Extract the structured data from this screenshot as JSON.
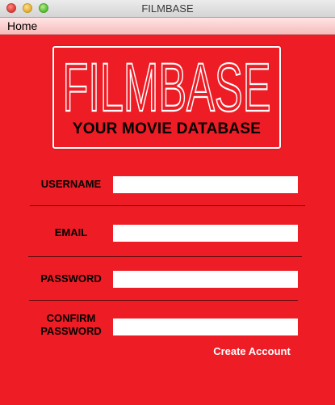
{
  "window": {
    "title": "FILMBASE"
  },
  "menu": {
    "items": [
      "Home"
    ]
  },
  "logo": {
    "wordmark": "FILMBASE",
    "tagline": "YOUR MOVIE DATABASE"
  },
  "form": {
    "username_label": "USERNAME",
    "email_label": "EMAIL",
    "password_label": "PASSWORD",
    "confirm_label_line1": "CONFIRM",
    "confirm_label_line2": "PASSWORD",
    "username_value": "",
    "email_value": "",
    "password_value": "",
    "confirm_value": "",
    "submit_label": "Create Account"
  },
  "colors": {
    "background": "#ee1c25",
    "field": "#ffffff",
    "button_text": "#ffffff",
    "divider": "#5a0a0d"
  }
}
